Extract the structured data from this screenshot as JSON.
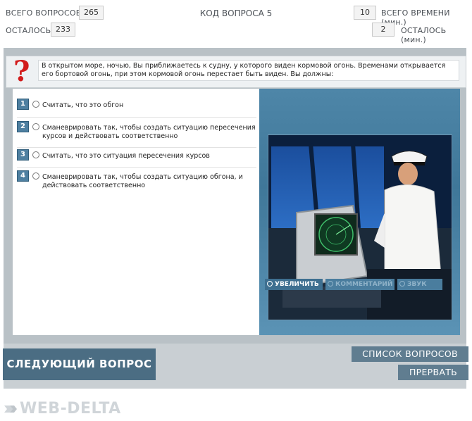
{
  "header": {
    "total_questions_label": "ВСЕГО ВОПРОСОВ",
    "total_questions_value": "265",
    "remaining_label": "ОСТАЛОСЬ",
    "remaining_value": "233",
    "question_code": "КОД ВОПРОСА 5",
    "total_time_value": "10",
    "total_time_label": "ВСЕГО ВРЕМЕНИ (мин.)",
    "time_left_value": "2",
    "time_left_label": "ОСТАЛОСЬ (мин.)"
  },
  "question": {
    "text": "В открытом море, ночью, Вы приближаетесь к судну, у которого виден кормовой огонь. Временами открывается его бортовой огонь, при этом кормовой огонь перестает быть виден. Вы должны:"
  },
  "answers": [
    {
      "num": "1",
      "text": "Считать, что это обгон"
    },
    {
      "num": "2",
      "text": "Сманеврировать так, чтобы создать ситуацию пересечения курсов и действовать соответственно"
    },
    {
      "num": "3",
      "text": "Считать, что это ситуация пересечения курсов"
    },
    {
      "num": "4",
      "text": "Сманеврировать так, чтобы создать ситуацию обгона, и действовать соответственно"
    }
  ],
  "image_toolbar": {
    "zoom_label": "УВЕЛИЧИТЬ",
    "comments_label": "КОММЕНТАРИЙ",
    "sound_label": "ЗВУК"
  },
  "buttons": {
    "next_label": "СЛЕДУЮЩИЙ ВОПРОС",
    "list_label": "СПИСОК ВОПРОСОВ",
    "abort_label": "ПРЕРВАТЬ"
  },
  "brand": {
    "logo_text": "WEB-DELTA"
  },
  "colors": {
    "accent": "#4b6d83",
    "question_mark": "#d21b1b",
    "number_badge": "#4e7fa0"
  }
}
